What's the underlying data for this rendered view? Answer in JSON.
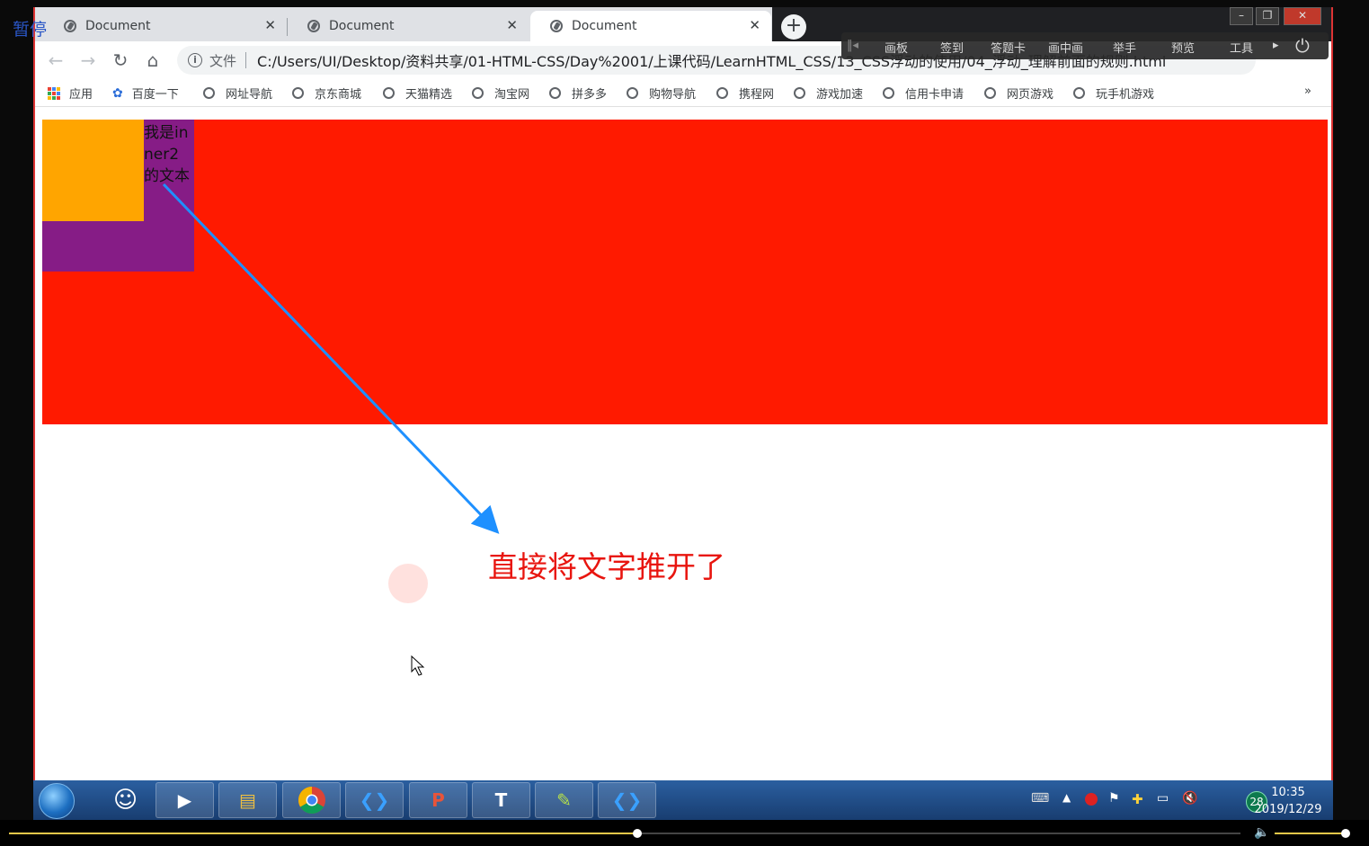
{
  "player_overlay": {
    "pause_label": "暂停"
  },
  "tabs": [
    {
      "title": "Document",
      "active": false
    },
    {
      "title": "Document",
      "active": false
    },
    {
      "title": "Document",
      "active": true
    }
  ],
  "address_bar": {
    "security_label": "文件",
    "url": "C:/Users/UI/Desktop/资料共享/01-HTML-CSS/Day%2001/上课代码/LearnHTML_CSS/13_CSS浮动的使用/04_浮动_理解前面的规则.html"
  },
  "bookmarks": [
    "应用",
    "百度一下",
    "网址导航",
    "京东商城",
    "天猫精选",
    "淘宝网",
    "拼多多",
    "购物导航",
    "携程网",
    "游戏加速",
    "信用卡申请",
    "网页游戏",
    "玩手机游戏"
  ],
  "bookmarks_overflow": "»",
  "class_toolbar": [
    "画板",
    "签到",
    "答题卡",
    "画中画",
    "举手",
    "预览",
    "工具"
  ],
  "page": {
    "inner2_text": "我是inner2的文本",
    "annotation": "直接将文字推开了",
    "colors": {
      "outer": "#ff1a00",
      "inner2": "#861c86",
      "inner1": "#ffa500",
      "annotation": "#e8150f",
      "arrow": "#1e90ff"
    }
  },
  "taskbar": {
    "apps": [
      "start-orb",
      "avatar",
      "media-player",
      "file-explorer",
      "chrome",
      "vscode",
      "powerpoint",
      "typora",
      "notepad",
      "vscode"
    ],
    "tray_badge": "28",
    "time": "10:35",
    "date": "2019/12/29"
  },
  "player": {
    "progress": 0.51,
    "volume": 0.95
  }
}
